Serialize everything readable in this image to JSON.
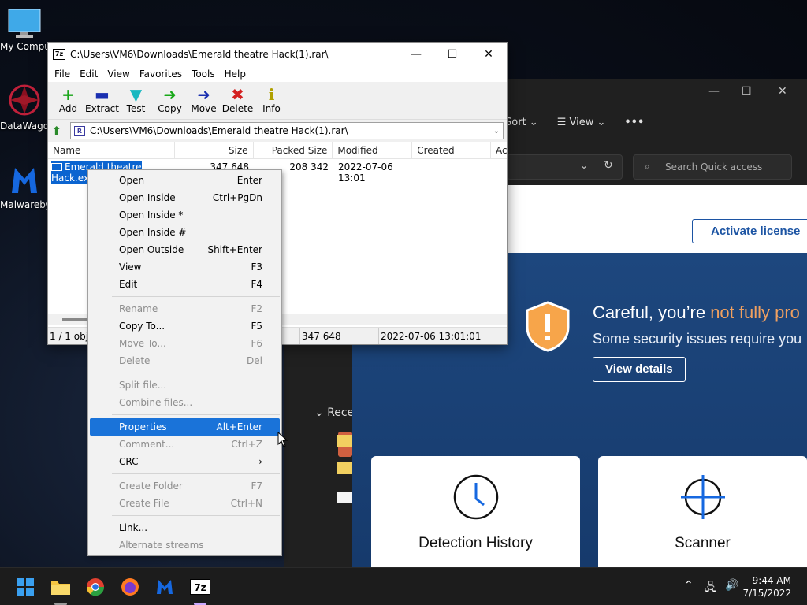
{
  "desktop": {
    "icons": [
      {
        "label": "My Compu"
      },
      {
        "label": "DataWago"
      },
      {
        "label": "Malwareby"
      }
    ]
  },
  "explorer": {
    "sort_label": "Sort",
    "view_label": "View",
    "more_label": "•••",
    "search_placeholder": "Search Quick access",
    "recent_label": "Recen"
  },
  "malwarebytes": {
    "activate_label": "Activate license",
    "careful_prefix": "Careful, you’re ",
    "careful_highlight": "not fully pro",
    "issues_text": "Some security issues require you",
    "details_label": "View details",
    "card1_title": "Detection History",
    "card2_title": "Scanner"
  },
  "sevenzip": {
    "title": "C:\\Users\\VM6\\Downloads\\Emerald theatre Hack(1).rar\\",
    "app_icon_text": "7z",
    "menu": [
      "File",
      "Edit",
      "View",
      "Favorites",
      "Tools",
      "Help"
    ],
    "toolbar": [
      {
        "label": "Add",
        "icon": "+",
        "color": "#1aa51a"
      },
      {
        "label": "Extract",
        "icon": "▬",
        "color": "#1a2fb0"
      },
      {
        "label": "Test",
        "icon": "▼",
        "color": "#18b8c0"
      },
      {
        "label": "Copy",
        "icon": "➜",
        "color": "#18a818"
      },
      {
        "label": "Move",
        "icon": "➜",
        "color": "#1a2fb0"
      },
      {
        "label": "Delete",
        "icon": "✖",
        "color": "#d42020"
      },
      {
        "label": "Info",
        "icon": "i",
        "color": "#b0a000"
      }
    ],
    "path": "C:\\Users\\VM6\\Downloads\\Emerald theatre Hack(1).rar\\",
    "path_icon_text": "R",
    "columns": [
      "Name",
      "Size",
      "Packed Size",
      "Modified",
      "Created",
      "Ac"
    ],
    "file": {
      "name": "Emerald theatre Hack.exe",
      "size": "347 648",
      "packed": "208 342",
      "modified": "2022-07-06 13:01"
    },
    "status": {
      "count": "1 / 1 obje",
      "size": "347 648",
      "date": "2022-07-06 13:01:01"
    }
  },
  "context_menu": [
    {
      "label": "Open",
      "shortcut": "Enter",
      "disabled": false
    },
    {
      "label": "Open Inside",
      "shortcut": "Ctrl+PgDn",
      "disabled": false
    },
    {
      "label": "Open Inside *",
      "shortcut": "",
      "disabled": false
    },
    {
      "label": "Open Inside #",
      "shortcut": "",
      "disabled": false
    },
    {
      "label": "Open Outside",
      "shortcut": "Shift+Enter",
      "disabled": false
    },
    {
      "label": "View",
      "shortcut": "F3",
      "disabled": false
    },
    {
      "label": "Edit",
      "shortcut": "F4",
      "disabled": false
    },
    {
      "sep": true
    },
    {
      "label": "Rename",
      "shortcut": "F2",
      "disabled": true
    },
    {
      "label": "Copy To...",
      "shortcut": "F5",
      "disabled": false
    },
    {
      "label": "Move To...",
      "shortcut": "F6",
      "disabled": true
    },
    {
      "label": "Delete",
      "shortcut": "Del",
      "disabled": true
    },
    {
      "sep": true
    },
    {
      "label": "Split file...",
      "shortcut": "",
      "disabled": true
    },
    {
      "label": "Combine files...",
      "shortcut": "",
      "disabled": true
    },
    {
      "sep": true
    },
    {
      "label": "Properties",
      "shortcut": "Alt+Enter",
      "disabled": false,
      "highlighted": true
    },
    {
      "label": "Comment...",
      "shortcut": "Ctrl+Z",
      "disabled": true
    },
    {
      "label": "CRC",
      "shortcut": "›",
      "disabled": false
    },
    {
      "sep": true
    },
    {
      "label": "Create Folder",
      "shortcut": "F7",
      "disabled": true
    },
    {
      "label": "Create File",
      "shortcut": "Ctrl+N",
      "disabled": true
    },
    {
      "sep": true
    },
    {
      "label": "Link...",
      "shortcut": "",
      "disabled": false
    },
    {
      "label": "Alternate streams",
      "shortcut": "",
      "disabled": true
    }
  ],
  "taskbar": {
    "time": "9:44 AM",
    "date": "7/15/2022",
    "sevenzip_icon_text": "7z"
  }
}
